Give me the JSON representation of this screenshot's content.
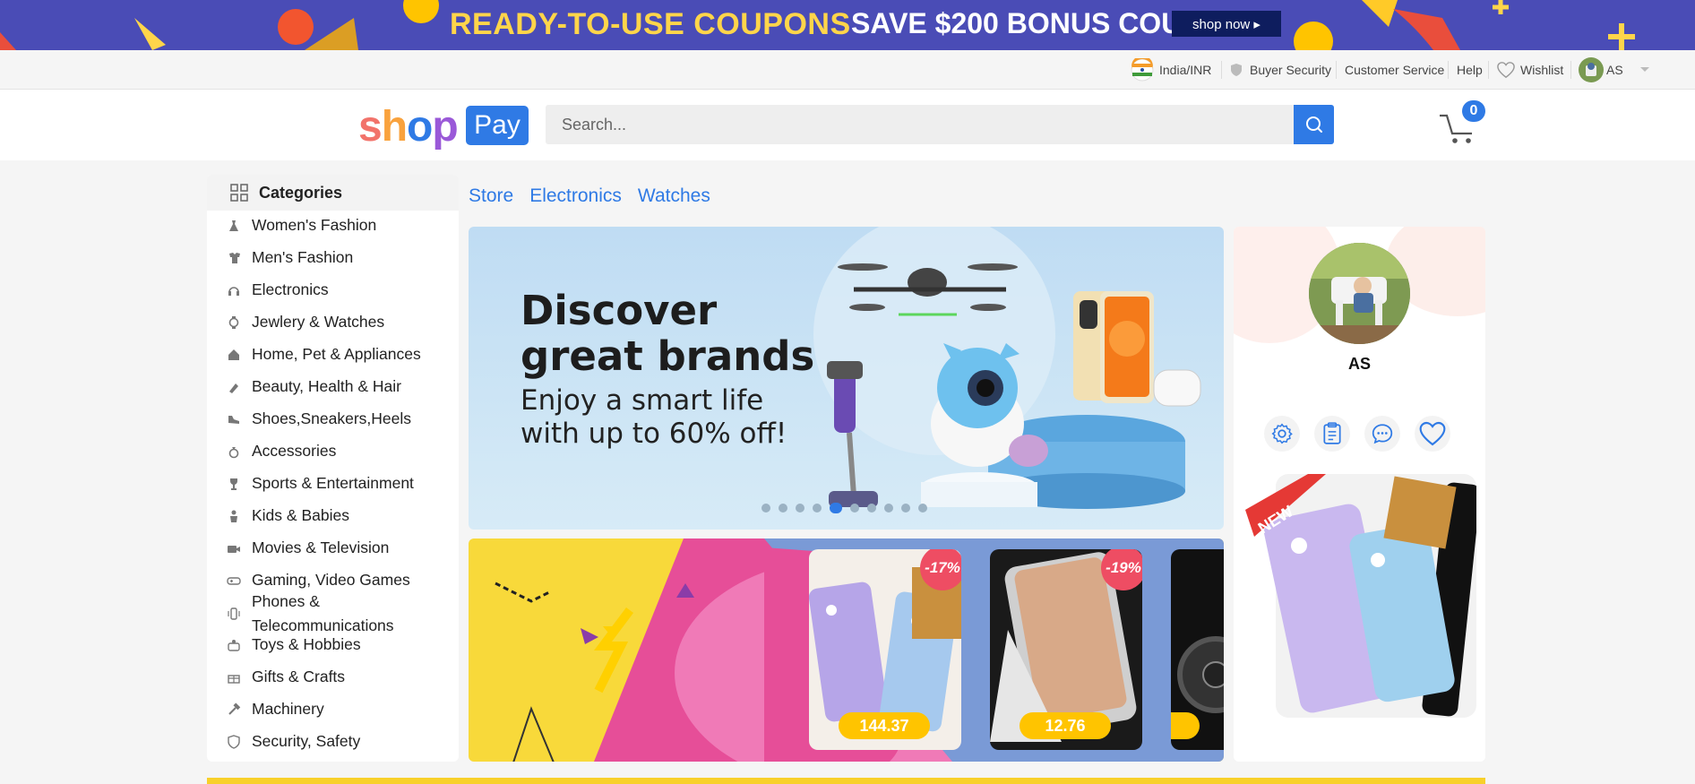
{
  "promo": {
    "title": "READY-TO-USE COUPONS",
    "subtitle": "SAVE $200 BONUS COUPON",
    "cta": "shop now ▸"
  },
  "topbar": {
    "region": "India/INR",
    "buyer_security": "Buyer Security",
    "customer_service": "Customer Service",
    "help": "Help",
    "wishlist": "Wishlist",
    "user": "AS"
  },
  "header": {
    "logo_shop": "shop",
    "logo_pay": "Pay",
    "search_placeholder": "Search...",
    "cart_count": "0",
    "logo_colors": [
      "#f2736b",
      "#f9a23d",
      "#2f7ae5",
      "#9a59d8"
    ]
  },
  "sidebar": {
    "title": "Categories",
    "items": [
      {
        "label": "Women's Fashion",
        "icon": "dress-icon"
      },
      {
        "label": "Men's Fashion",
        "icon": "shirt-icon"
      },
      {
        "label": "Electronics",
        "icon": "headphones-icon"
      },
      {
        "label": "Jewlery & Watches",
        "icon": "watch-icon"
      },
      {
        "label": "Home, Pet & Appliances",
        "icon": "home-icon"
      },
      {
        "label": "Beauty, Health & Hair",
        "icon": "lipstick-icon"
      },
      {
        "label": "Shoes,Sneakers,Heels",
        "icon": "shoe-icon"
      },
      {
        "label": "Accessories",
        "icon": "ring-icon"
      },
      {
        "label": "Sports & Entertainment",
        "icon": "trophy-icon"
      },
      {
        "label": "Kids & Babies",
        "icon": "baby-icon"
      },
      {
        "label": "Movies & Television",
        "icon": "camera-icon"
      },
      {
        "label": "Gaming, Video Games",
        "icon": "gamepad-icon"
      },
      {
        "label": "Phones & Telecommunications",
        "icon": "phone-icon"
      },
      {
        "label": "Toys & Hobbies",
        "icon": "toy-icon"
      },
      {
        "label": "Gifts & Crafts",
        "icon": "gift-icon"
      },
      {
        "label": "Machinery",
        "icon": "hammer-icon"
      },
      {
        "label": "Security, Safety",
        "icon": "shield-icon"
      }
    ]
  },
  "breadcrumbs": [
    "Store",
    "Electronics",
    "Watches"
  ],
  "hero": {
    "headline_1": "Discover",
    "headline_2": "great brands",
    "sub_1": "Enjoy a smart life",
    "sub_2": "with up to 60% off!",
    "slides": 10,
    "active_slide": 5
  },
  "deals": [
    {
      "price": "144.37",
      "discount": "-17%"
    },
    {
      "price": "12.76",
      "discount": "-19%"
    },
    {
      "price": "",
      "discount": ""
    }
  ],
  "profile": {
    "name": "AS",
    "new_badge": "NEW",
    "actions": [
      "settings-icon",
      "orders-icon",
      "messages-icon",
      "wishlist-icon"
    ]
  },
  "colors": {
    "accent": "#2f7ae5",
    "promo_bg": "#4a4cb6",
    "deal_bg": "#f8d93a",
    "sale": "#ee4d63"
  }
}
